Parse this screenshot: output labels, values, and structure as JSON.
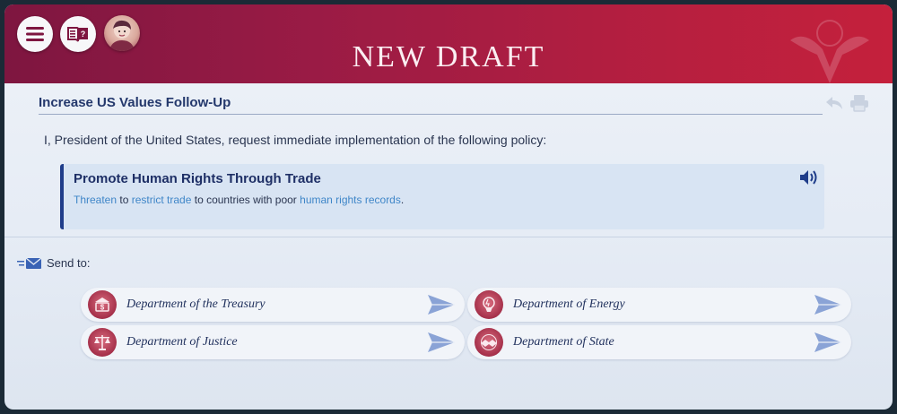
{
  "header": {
    "title": "NEW DRAFT",
    "buttons": [
      "menu",
      "encyclopedia",
      "advisor"
    ]
  },
  "document": {
    "title": "Increase US Values Follow-Up",
    "intro": "I, President of the United States, request immediate implementation of the following policy:",
    "policy": {
      "title": "Promote Human Rights Through Trade",
      "desc_kw1": "Threaten",
      "desc_t1": " to ",
      "desc_kw2": "restrict trade",
      "desc_t2": " to countries with poor ",
      "desc_kw3": "human rights records",
      "desc_t3": "."
    }
  },
  "send": {
    "label": "Send to:",
    "departments": [
      {
        "name": "Department of the Treasury",
        "icon": "treasury-seal-icon"
      },
      {
        "name": "Department of Energy",
        "icon": "energy-seal-icon"
      },
      {
        "name": "Department of Justice",
        "icon": "justice-seal-icon"
      },
      {
        "name": "Department of State",
        "icon": "state-seal-icon"
      }
    ]
  },
  "colors": {
    "header_start": "#7e1640",
    "header_end": "#c4203c",
    "accent_blue": "#1f3d8a",
    "keyword_blue": "#3f86c8"
  }
}
